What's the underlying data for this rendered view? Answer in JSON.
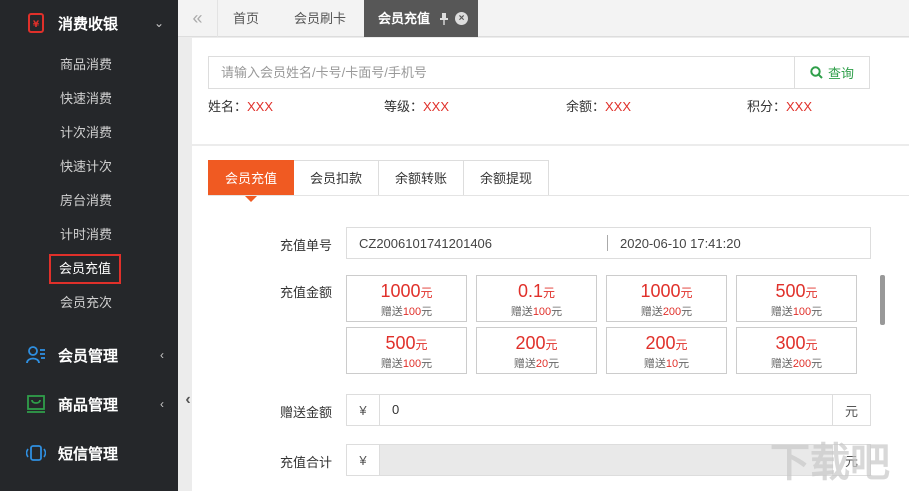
{
  "sidebar": {
    "section_consume": {
      "label": "消费收银",
      "arrow": "⌄"
    },
    "items": [
      {
        "label": "商品消费",
        "active": false
      },
      {
        "label": "快速消费",
        "active": false
      },
      {
        "label": "计次消费",
        "active": false
      },
      {
        "label": "快速计次",
        "active": false
      },
      {
        "label": "房台消费",
        "active": false
      },
      {
        "label": "计时消费",
        "active": false
      },
      {
        "label": "会员充值",
        "active": true
      },
      {
        "label": "会员充次",
        "active": false
      }
    ],
    "section_member": {
      "label": "会员管理",
      "arrow": "‹"
    },
    "section_goods": {
      "label": "商品管理",
      "arrow": "‹"
    },
    "section_sms": {
      "label": "短信管理"
    }
  },
  "tabbar": {
    "nav_glyph": "«",
    "tabs": [
      {
        "label": "首页"
      },
      {
        "label": "会员刷卡"
      },
      {
        "label": "会员充值",
        "active": true
      }
    ]
  },
  "search": {
    "placeholder": "请输入会员姓名/卡号/卡面号/手机号",
    "value": "",
    "button_label": "查询"
  },
  "member_info": {
    "name_label": "姓名：",
    "name_value": "XXX",
    "level_label": "等级：",
    "level_value": "XXX",
    "balance_label": "余额：",
    "balance_value": "XXX",
    "points_label": "积分：",
    "points_value": "XXX"
  },
  "subtabs": [
    {
      "label": "会员充值",
      "active": true
    },
    {
      "label": "会员扣款"
    },
    {
      "label": "余额转账"
    },
    {
      "label": "余额提现"
    }
  ],
  "form": {
    "order_label": "充值单号",
    "order_no": "CZ2006101741201406",
    "order_time": "2020-06-10 17:41:20",
    "amount_label": "充值金额",
    "amounts": [
      {
        "amount": "1000",
        "unit": "元",
        "gift_prefix": "赠送",
        "gift": "100",
        "gift_unit": "元"
      },
      {
        "amount": "0.1",
        "unit": "元",
        "gift_prefix": "赠送",
        "gift": "100",
        "gift_unit": "元"
      },
      {
        "amount": "1000",
        "unit": "元",
        "gift_prefix": "赠送",
        "gift": "200",
        "gift_unit": "元"
      },
      {
        "amount": "500",
        "unit": "元",
        "gift_prefix": "赠送",
        "gift": "100",
        "gift_unit": "元"
      },
      {
        "amount": "500",
        "unit": "元",
        "gift_prefix": "赠送",
        "gift": "100",
        "gift_unit": "元"
      },
      {
        "amount": "200",
        "unit": "元",
        "gift_prefix": "赠送",
        "gift": "20",
        "gift_unit": "元"
      },
      {
        "amount": "200",
        "unit": "元",
        "gift_prefix": "赠送",
        "gift": "10",
        "gift_unit": "元"
      },
      {
        "amount": "300",
        "unit": "元",
        "gift_prefix": "赠送",
        "gift": "200",
        "gift_unit": "元"
      }
    ],
    "gift_label": "赠送金额",
    "currency": "¥",
    "gift_value": "0",
    "unit": "元",
    "total_label": "充值合计",
    "total_value": ""
  },
  "colors": {
    "accent": "#f05a22",
    "danger": "#e0302a",
    "success": "#2f9f4a",
    "sidebar": "#25272a"
  },
  "watermark": {
    "text": "下载吧"
  }
}
